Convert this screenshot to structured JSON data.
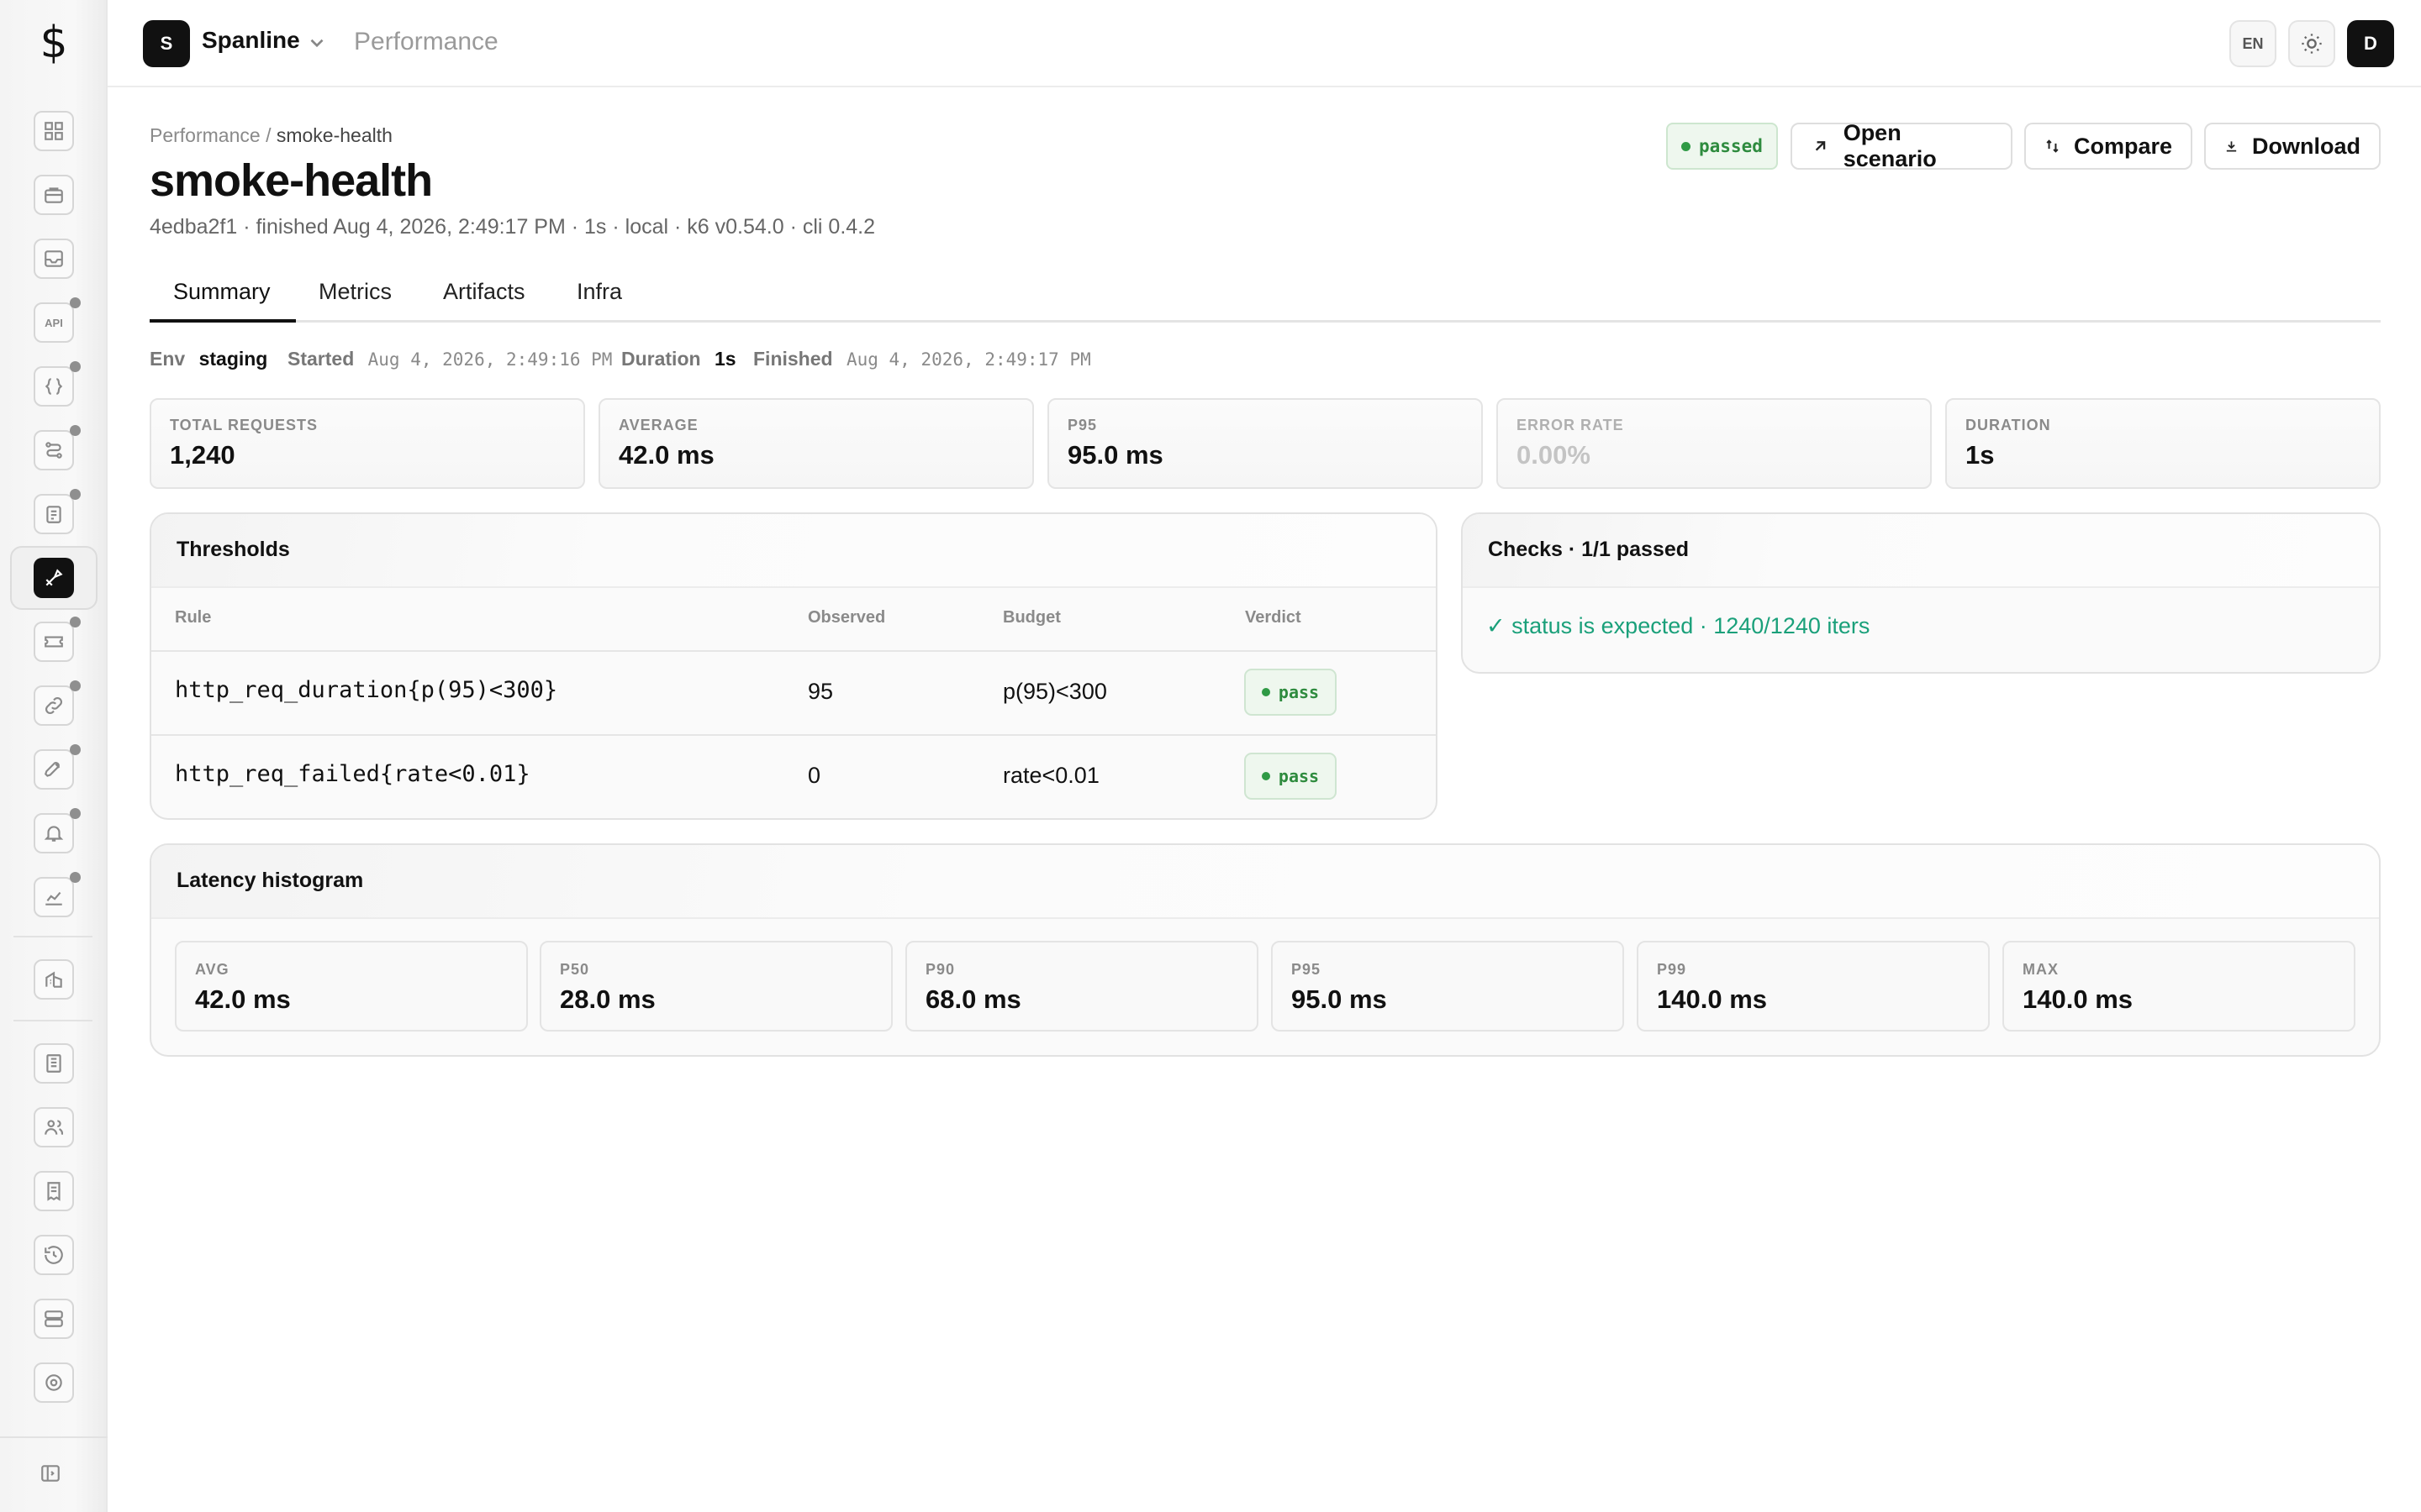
{
  "sidebar": {
    "logo": "$",
    "icons": [
      "dashboard-icon",
      "briefcase-icon",
      "inbox-icon",
      "api-icon",
      "braces-icon",
      "workflow-icon",
      "clipboard-icon",
      "performance-icon",
      "ticket-icon",
      "link-icon",
      "rocket-icon",
      "bell-icon",
      "chart-icon",
      "building-icon",
      "table-icon",
      "users-icon",
      "receipt-icon",
      "history-icon",
      "storage-icon",
      "gear-icon",
      "collapse-sidebar-icon"
    ],
    "api_label": "API"
  },
  "topbar": {
    "workspace_initial": "S",
    "workspace_name": "Spanline",
    "section": "Performance",
    "language": "EN",
    "user_initial": "D"
  },
  "header": {
    "breadcrumb_parent": "Performance",
    "breadcrumb_sep": "/",
    "breadcrumb_current": "smoke-health",
    "title": "smoke-health",
    "meta": "4edba2f1 · finished Aug 4, 2026, 2:49:17 PM · 1s · local · k6 v0.54.0 · cli 0.4.2",
    "status": "passed",
    "actions": {
      "open_scenario": "Open scenario",
      "compare": "Compare",
      "download": "Download"
    }
  },
  "tabs": [
    "Summary",
    "Metrics",
    "Artifacts",
    "Infra"
  ],
  "run_info": {
    "env_label": "Env",
    "env_value": "staging",
    "started_label": "Started",
    "started_value": "Aug 4, 2026, 2:49:16 PM",
    "duration_label": "Duration",
    "duration_value": "1s",
    "finished_label": "Finished",
    "finished_value": "Aug 4, 2026, 2:49:17 PM"
  },
  "stats": [
    {
      "label": "TOTAL REQUESTS",
      "value": "1,240"
    },
    {
      "label": "AVERAGE",
      "value": "42.0 ms"
    },
    {
      "label": "P95",
      "value": "95.0 ms"
    },
    {
      "label": "ERROR RATE",
      "value": "0.00%"
    },
    {
      "label": "DURATION",
      "value": "1s"
    }
  ],
  "thresholds": {
    "title": "Thresholds",
    "columns": [
      "Rule",
      "Observed",
      "Budget",
      "Verdict"
    ],
    "rows": [
      {
        "rule": "http_req_duration{p(95)<300}",
        "observed": "95",
        "budget": "p(95)<300",
        "verdict": "pass"
      },
      {
        "rule": "http_req_failed{rate<0.01}",
        "observed": "0",
        "budget": "rate<0.01",
        "verdict": "pass"
      }
    ]
  },
  "checks": {
    "title": "Checks · 1/1 passed",
    "items": [
      "✓ status is expected · 1240/1240 iters"
    ]
  },
  "latency": {
    "title": "Latency histogram",
    "cards": [
      {
        "label": "AVG",
        "value": "42.0 ms"
      },
      {
        "label": "P50",
        "value": "28.0 ms"
      },
      {
        "label": "P90",
        "value": "68.0 ms"
      },
      {
        "label": "P95",
        "value": "95.0 ms"
      },
      {
        "label": "P99",
        "value": "140.0 ms"
      },
      {
        "label": "MAX",
        "value": "140.0 ms"
      }
    ]
  }
}
